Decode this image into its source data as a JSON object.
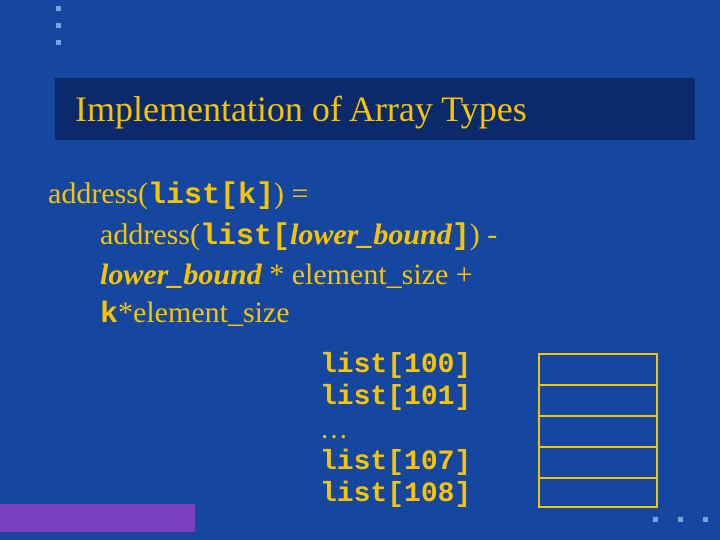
{
  "title": "Implementation of Array Types",
  "formula": {
    "line1_a": "address(",
    "line1_b": "list[k]",
    "line1_c": ") =",
    "line2_a": "address(",
    "line2_b": "list[",
    "line2_c": "lower_bound",
    "line2_d": "]",
    "line2_e": ") -",
    "line3_a": "lower_bound",
    "line3_b": " * element_size +",
    "line4_a": "k",
    "line4_b": "*element_size"
  },
  "array_labels": {
    "row0": "list[100]",
    "row1": "list[101]",
    "row2": "…",
    "row3": "list[107]",
    "row4": "list[108]"
  }
}
